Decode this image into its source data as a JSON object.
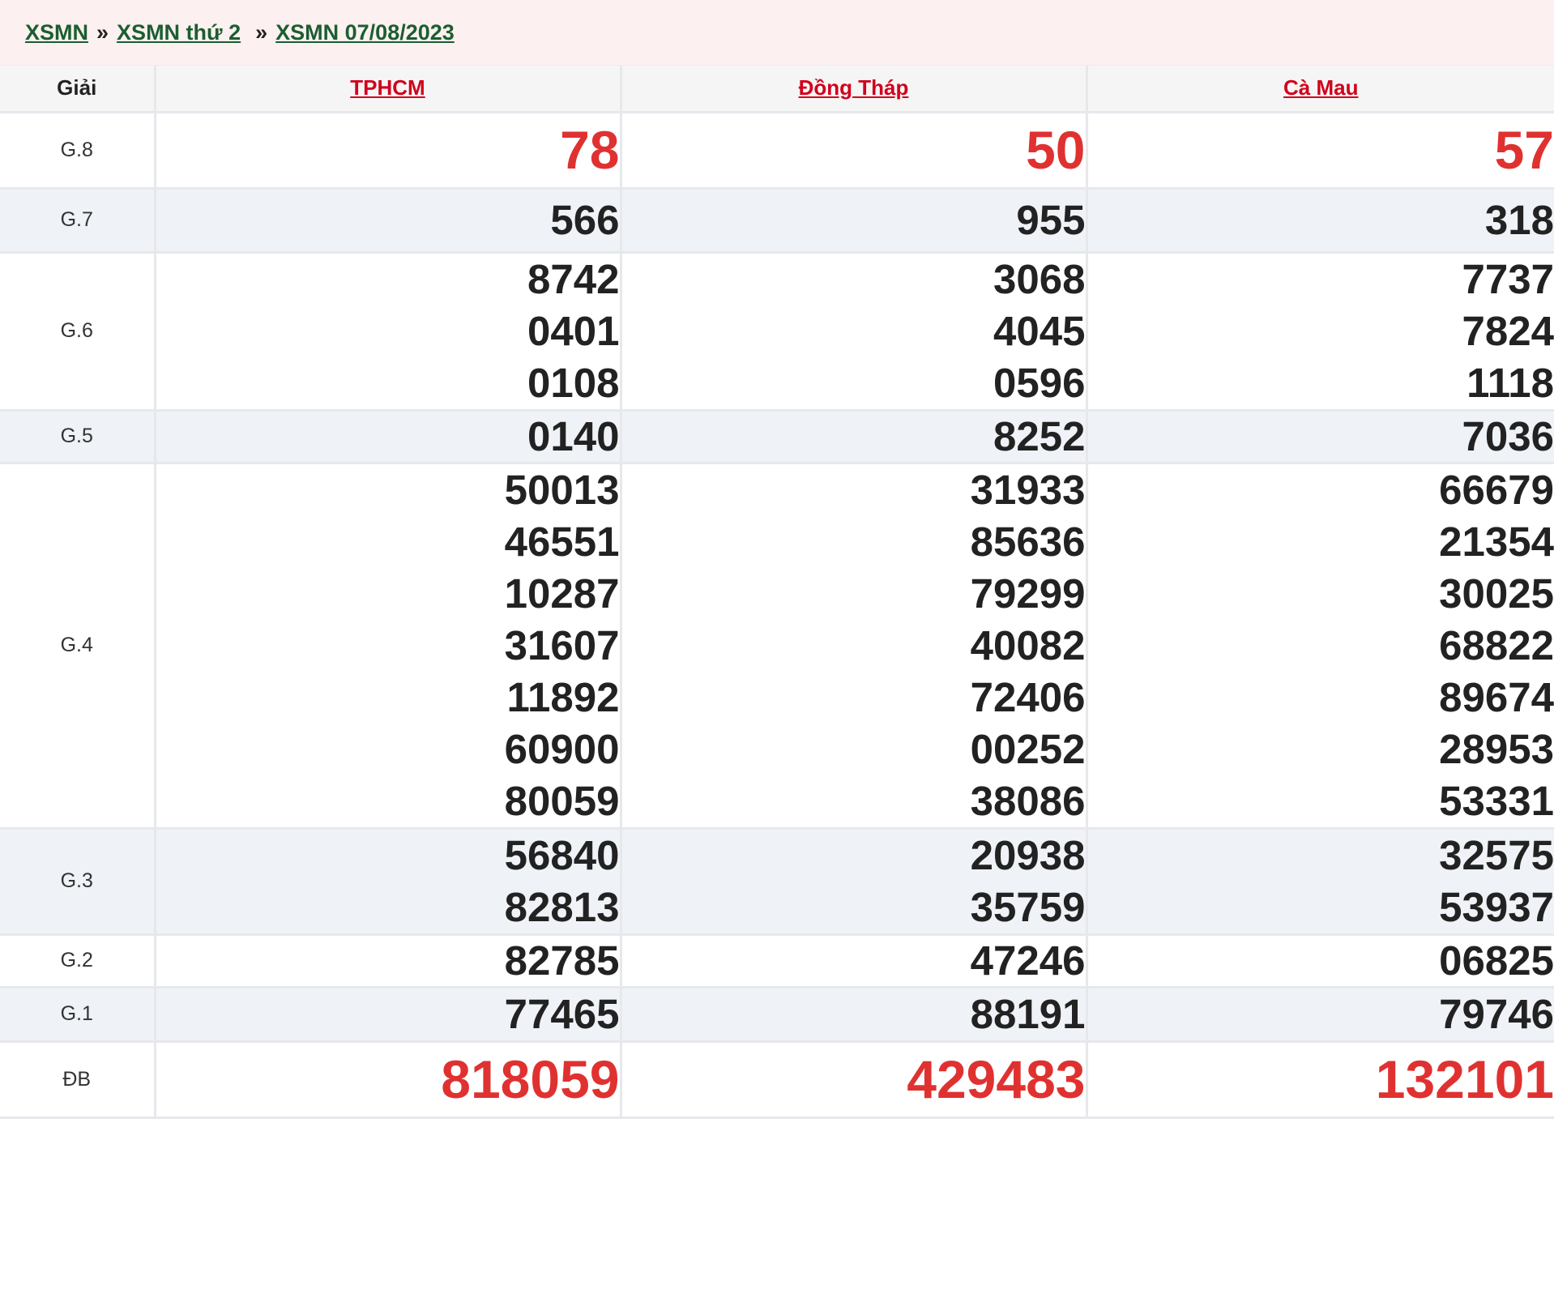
{
  "breadcrumb": {
    "link1": "XSMN",
    "sep": "»",
    "link2": "XSMN thứ 2",
    "link3": "XSMN 07/08/2023"
  },
  "table": {
    "header_prize": "Giải",
    "provinces": [
      "TPHCM",
      "Đồng Tháp",
      "Cà Mau"
    ],
    "rows": [
      {
        "label": "G.8",
        "cols": [
          [
            "78"
          ],
          [
            "50"
          ],
          [
            "57"
          ]
        ]
      },
      {
        "label": "G.7",
        "cols": [
          [
            "566"
          ],
          [
            "955"
          ],
          [
            "318"
          ]
        ]
      },
      {
        "label": "G.6",
        "cols": [
          [
            "8742",
            "0401",
            "0108"
          ],
          [
            "3068",
            "4045",
            "0596"
          ],
          [
            "7737",
            "7824",
            "1118"
          ]
        ]
      },
      {
        "label": "G.5",
        "cols": [
          [
            "0140"
          ],
          [
            "8252"
          ],
          [
            "7036"
          ]
        ]
      },
      {
        "label": "G.4",
        "cols": [
          [
            "50013",
            "46551",
            "10287",
            "31607",
            "11892",
            "60900",
            "80059"
          ],
          [
            "31933",
            "85636",
            "79299",
            "40082",
            "72406",
            "00252",
            "38086"
          ],
          [
            "66679",
            "21354",
            "30025",
            "68822",
            "89674",
            "28953",
            "53331"
          ]
        ]
      },
      {
        "label": "G.3",
        "cols": [
          [
            "56840",
            "82813"
          ],
          [
            "20938",
            "35759"
          ],
          [
            "32575",
            "53937"
          ]
        ]
      },
      {
        "label": "G.2",
        "cols": [
          [
            "82785"
          ],
          [
            "47246"
          ],
          [
            "06825"
          ]
        ]
      },
      {
        "label": "G.1",
        "cols": [
          [
            "77465"
          ],
          [
            "88191"
          ],
          [
            "79746"
          ]
        ]
      },
      {
        "label": "ĐB",
        "cols": [
          [
            "818059"
          ],
          [
            "429483"
          ],
          [
            "132101"
          ]
        ]
      }
    ]
  },
  "colors": {
    "link_green": "#1b5e30",
    "province_red": "#d0021b",
    "highlight_red": "#e03131",
    "alt_row_bg": "#eff2f6",
    "breadcrumb_bg": "#fdf0f0"
  }
}
